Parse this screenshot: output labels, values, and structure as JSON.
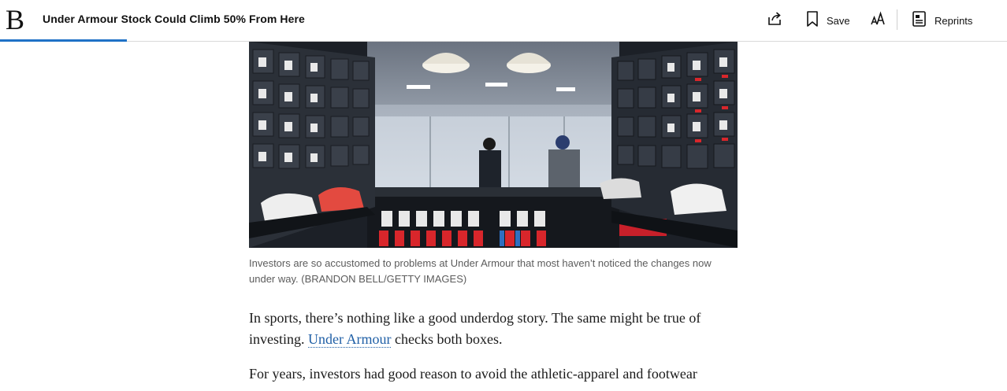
{
  "header": {
    "logo": "B",
    "headline": "Under Armour Stock Could Climb 50% From Here",
    "reading_progress_percent": 12.6,
    "share_icon": "share-icon",
    "save_label": "Save",
    "save_icon": "bookmark-icon",
    "text_size_icon": "text-size-icon",
    "reprints_label": "Reprints",
    "reprints_icon": "document-icon"
  },
  "article": {
    "image_alt": "Under Armour store interior with shoe boxes on shelves",
    "caption": "Investors are so accustomed to problems at Under Armour that most haven’t noticed the changes now under way. (BRANDON BELL/GETTY IMAGES)",
    "p1_before": "In sports, there’s nothing like a good underdog story. The same might be true of investing. ",
    "p1_link": "Under Armour",
    "p1_after": " checks both boxes.",
    "p2": "For years, investors had good reason to avoid the athletic-apparel and footwear"
  },
  "colors": {
    "accent": "#1f72c7",
    "link": "#1f5fa6",
    "caption": "#5c5c5c"
  }
}
